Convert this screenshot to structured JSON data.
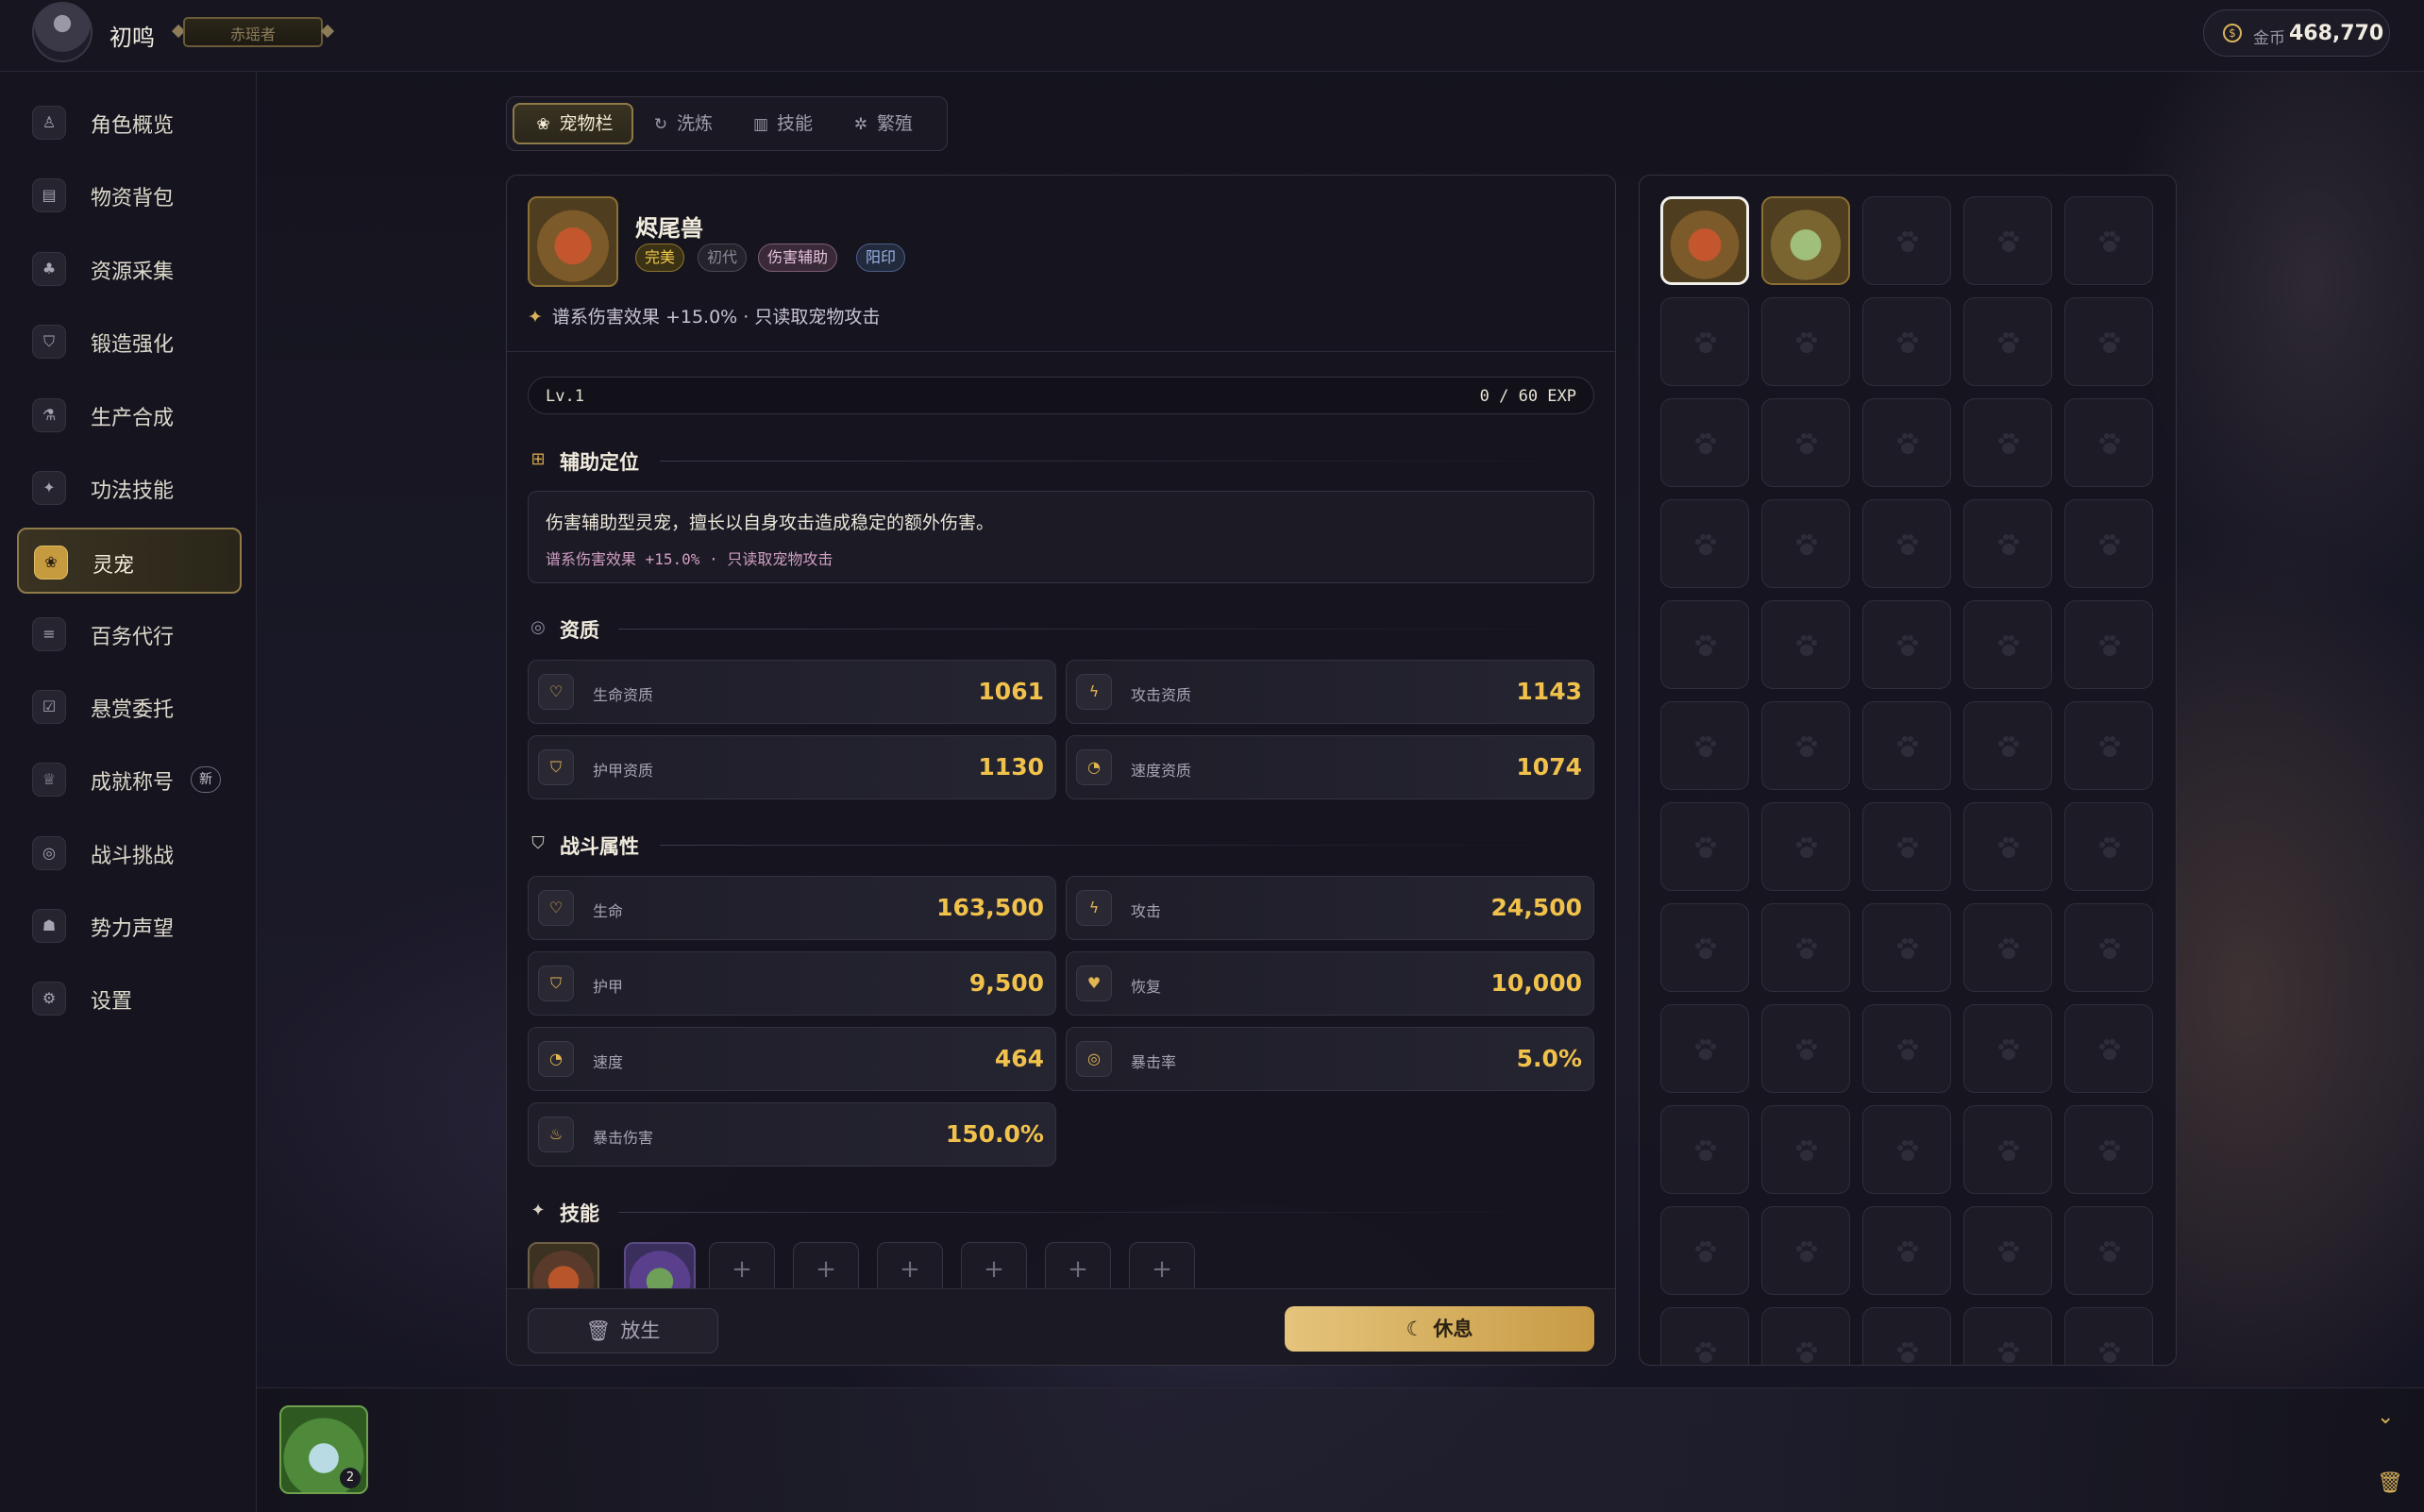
{
  "header": {
    "player_name": "初鸣",
    "player_title": "赤瑶者",
    "currency_label": "金币",
    "currency_value": "468,770"
  },
  "sidebar": {
    "items": [
      {
        "label": "角色概览",
        "icon": "user-icon",
        "glyph": "♙"
      },
      {
        "label": "物资背包",
        "icon": "bag-icon",
        "glyph": "▤"
      },
      {
        "label": "资源采集",
        "icon": "tree-icon",
        "glyph": "♣"
      },
      {
        "label": "锻造强化",
        "icon": "shield-icon",
        "glyph": "⛉"
      },
      {
        "label": "生产合成",
        "icon": "flask-icon",
        "glyph": "⚗"
      },
      {
        "label": "功法技能",
        "icon": "sparkle-icon",
        "glyph": "✦"
      },
      {
        "label": "灵宠",
        "icon": "paw-icon",
        "glyph": "❀",
        "active": true
      },
      {
        "label": "百务代行",
        "icon": "list-check-icon",
        "glyph": "≡"
      },
      {
        "label": "悬赏委托",
        "icon": "clipboard-icon",
        "glyph": "☑"
      },
      {
        "label": "成就称号",
        "icon": "trophy-icon",
        "glyph": "♕",
        "badge": "新"
      },
      {
        "label": "战斗挑战",
        "icon": "target-icon",
        "glyph": "◎"
      },
      {
        "label": "势力声望",
        "icon": "users-icon",
        "glyph": "☗"
      },
      {
        "label": "设置",
        "icon": "gear-icon",
        "glyph": "⚙"
      }
    ]
  },
  "tabs": [
    {
      "label": "宠物栏",
      "icon": "paw-icon",
      "glyph": "❀",
      "active": true
    },
    {
      "label": "洗炼",
      "icon": "refresh-icon",
      "glyph": "↻"
    },
    {
      "label": "技能",
      "icon": "book-icon",
      "glyph": "▥"
    },
    {
      "label": "繁殖",
      "icon": "flower-icon",
      "glyph": "✲"
    }
  ],
  "pet": {
    "name": "烬尾兽",
    "tags": [
      "完美",
      "初代",
      "伤害辅助",
      "阳印"
    ],
    "passive": "谱系伤害效果 +15.0% · 只读取宠物攻击",
    "level": "Lv.1",
    "exp": "0 / 60 EXP"
  },
  "support": {
    "title": "辅助定位",
    "description": "伤害辅助型灵宠，擅长以自身攻击造成稳定的额外伤害。",
    "detail": "谱系伤害效果 +15.0% · 只读取宠物攻击"
  },
  "aptitude": {
    "title": "资质",
    "stats": [
      {
        "label": "生命资质",
        "value": "1061",
        "icon": "heart-icon",
        "glyph": "♡"
      },
      {
        "label": "攻击资质",
        "value": "1143",
        "icon": "bolt-icon",
        "glyph": "ϟ"
      },
      {
        "label": "护甲资质",
        "value": "1130",
        "icon": "shield-icon",
        "glyph": "⛉"
      },
      {
        "label": "速度资质",
        "value": "1074",
        "icon": "gauge-icon",
        "glyph": "◔"
      }
    ]
  },
  "combat": {
    "title": "战斗属性",
    "stats": [
      {
        "label": "生命",
        "value": "163,500",
        "icon": "heart-icon",
        "glyph": "♡"
      },
      {
        "label": "攻击",
        "value": "24,500",
        "icon": "bolt-icon",
        "glyph": "ϟ"
      },
      {
        "label": "护甲",
        "value": "9,500",
        "icon": "shield-icon",
        "glyph": "⛉"
      },
      {
        "label": "恢复",
        "value": "10,000",
        "icon": "heart-filled-icon",
        "glyph": "♥"
      },
      {
        "label": "速度",
        "value": "464",
        "icon": "gauge-icon",
        "glyph": "◔"
      },
      {
        "label": "暴击率",
        "value": "5.0%",
        "icon": "crosshair-icon",
        "glyph": "◎"
      },
      {
        "label": "暴击伤害",
        "value": "150.0%",
        "icon": "flame-icon",
        "glyph": "♨"
      }
    ]
  },
  "skills": {
    "title": "技能",
    "empty_glyph": "+"
  },
  "actions": {
    "release": "放生",
    "rest": "休息"
  },
  "grid": {
    "paw_glyph": "paw-icon"
  },
  "bottom": {
    "potion_count": "2"
  }
}
